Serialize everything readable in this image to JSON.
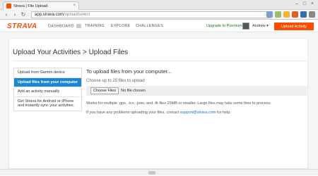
{
  "browser": {
    "tab_title": "Strava | File Upload",
    "tab_close": "×",
    "url_host": "app.strava.com",
    "url_path": "/upload/select",
    "controls": [
      "–",
      "□",
      "×"
    ],
    "nav": [
      "‹",
      "›",
      "↻"
    ],
    "star": "☆"
  },
  "header": {
    "logo": "STRAVA",
    "nav": [
      {
        "label": "DASHBOARD"
      },
      {
        "label": "TRAINING"
      },
      {
        "label": "EXPLORE"
      },
      {
        "label": "CHALLENGES"
      }
    ],
    "upgrade": "Upgrade to Premium",
    "user": "Andrew ▾",
    "upload_button": "Upload Activity"
  },
  "page": {
    "title": "Upload Your Activities > Upload Files",
    "sidebar": [
      {
        "label": "Upload from Garmin device",
        "active": false
      },
      {
        "label": "Upload files from your computer",
        "active": true
      },
      {
        "label": "Add an activity manually",
        "active": false
      },
      {
        "label": "Get Strava for Android or iPhone and instantly sync your activities.",
        "active": false
      }
    ],
    "heading": "To upload files from your computer...",
    "subheading": "Choose up to 25 files to upload",
    "choose_button": "Choose Files",
    "no_file": "No file chosen",
    "formats_note": "Works for multiple .gpx, .tcx, .json, and .fit files 25MB or smaller. Large files may take some time to process.",
    "help_prefix": "If you have any problems uploading your files, contact ",
    "help_link": "support@strava.com",
    "help_suffix": " for help."
  },
  "colors": {
    "brand": "#fc4c02",
    "active_item": "#1b87d1",
    "upgrade": "#0a7a2a",
    "link": "#1b6fc4"
  }
}
